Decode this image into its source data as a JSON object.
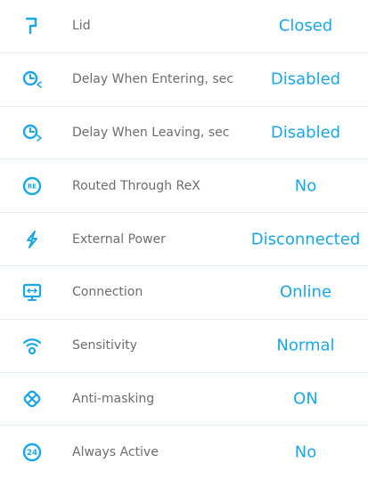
{
  "rows": [
    {
      "icon": "lid-icon",
      "label": "Lid",
      "value": "Closed"
    },
    {
      "icon": "delay-entering-icon",
      "label": "Delay When Entering, sec",
      "value": "Disabled"
    },
    {
      "icon": "delay-leaving-icon",
      "label": "Delay When Leaving, sec",
      "value": "Disabled"
    },
    {
      "icon": "rex-icon",
      "label": "Routed Through ReX",
      "value": "No"
    },
    {
      "icon": "lightning-icon",
      "label": "External Power",
      "value": "Disconnected"
    },
    {
      "icon": "connection-icon",
      "label": "Connection",
      "value": "Online"
    },
    {
      "icon": "sensitivity-icon",
      "label": "Sensitivity",
      "value": "Normal"
    },
    {
      "icon": "anti-masking-icon",
      "label": "Anti-masking",
      "value": "ON"
    },
    {
      "icon": "always-active-icon",
      "label": "Always Active",
      "value": "No"
    }
  ],
  "colors": {
    "accent": "#19a7ea",
    "label": "#6d6d6d",
    "divider": "#e9eef2"
  }
}
